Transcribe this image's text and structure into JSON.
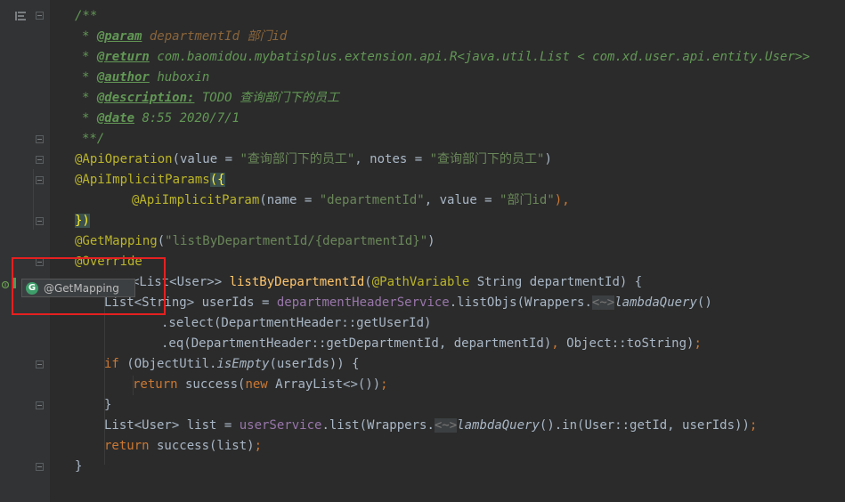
{
  "code": {
    "javadoc_open": "/**",
    "param_tag": "@param",
    "param_value": "departmentId 部门id",
    "return_tag": "@return",
    "return_value": "com.baomidou.mybatisplus.extension.api.R<java.util.List < com.xd.user.api.entity.User>>",
    "author_tag": "@author",
    "author_value": "huboxin",
    "description_tag": "@description:",
    "description_value": "TODO 查询部门下的员工",
    "date_tag": "@date",
    "date_value": "8:55 2020/7/1",
    "javadoc_close": "**/",
    "api_operation": "@ApiOperation",
    "api_operation_args_1": "(value = ",
    "api_operation_value": "\"查询部门下的员工\"",
    "api_operation_args_2": ", notes = ",
    "api_operation_notes": "\"查询部门下的员工\"",
    "api_operation_args_3": ")",
    "implicit_params": "@ApiImplicitParams",
    "implicit_params_open": "({",
    "implicit_param": "@ApiImplicitParam",
    "implicit_param_args_1": "(name = ",
    "implicit_param_name": "\"departmentId\"",
    "implicit_param_args_2": ", value = ",
    "implicit_param_value": "\"部门id\"",
    "implicit_param_args_3": "),",
    "implicit_params_close": "})",
    "get_mapping": "@GetMapping",
    "get_mapping_open": "(",
    "get_mapping_path": "\"listByDepartmentId/{departmentId}\"",
    "get_mapping_close": ")",
    "override": "@Override",
    "method_sig_1": "<List<User>> ",
    "method_name": "listByDepartmentId",
    "method_sig_2": "(",
    "path_variable": "@PathVariable",
    "method_sig_3": " String departmentId) {",
    "line_userids_1": "List<String> userIds = ",
    "line_userids_field": "departmentHeaderService",
    "line_userids_2": ".listObjs(Wrappers.",
    "lambda_hint": "<~>",
    "lambda_query": "lambdaQuery",
    "line_userids_3": "()",
    "line_select": ".select(DepartmentHeader::getUserId)",
    "line_eq_1": ".eq(DepartmentHeader::getDepartmentId, departmentId)",
    "line_eq_comma": ", ",
    "line_eq_2": "Object::toString)",
    "line_eq_semi": ";",
    "if_kw": "if",
    "if_1": " (ObjectUtil.",
    "is_empty": "isEmpty",
    "if_2": "(userIds)) {",
    "return_kw": "return",
    "return_1": " success(",
    "new_kw": "new",
    "return_2": " ArrayList<>())",
    "return_semi": ";",
    "close_brace": "}",
    "list_1": "List<User> list = ",
    "list_field": "userService",
    "list_2": ".list(Wrappers.",
    "list_3": "().in(User::getId, userIds))",
    "list_semi": ";",
    "return_list_1": " success(list)",
    "return_list_semi": ";",
    "method_close": "}"
  },
  "tooltip": {
    "badge": "G",
    "label": "@GetMapping"
  }
}
